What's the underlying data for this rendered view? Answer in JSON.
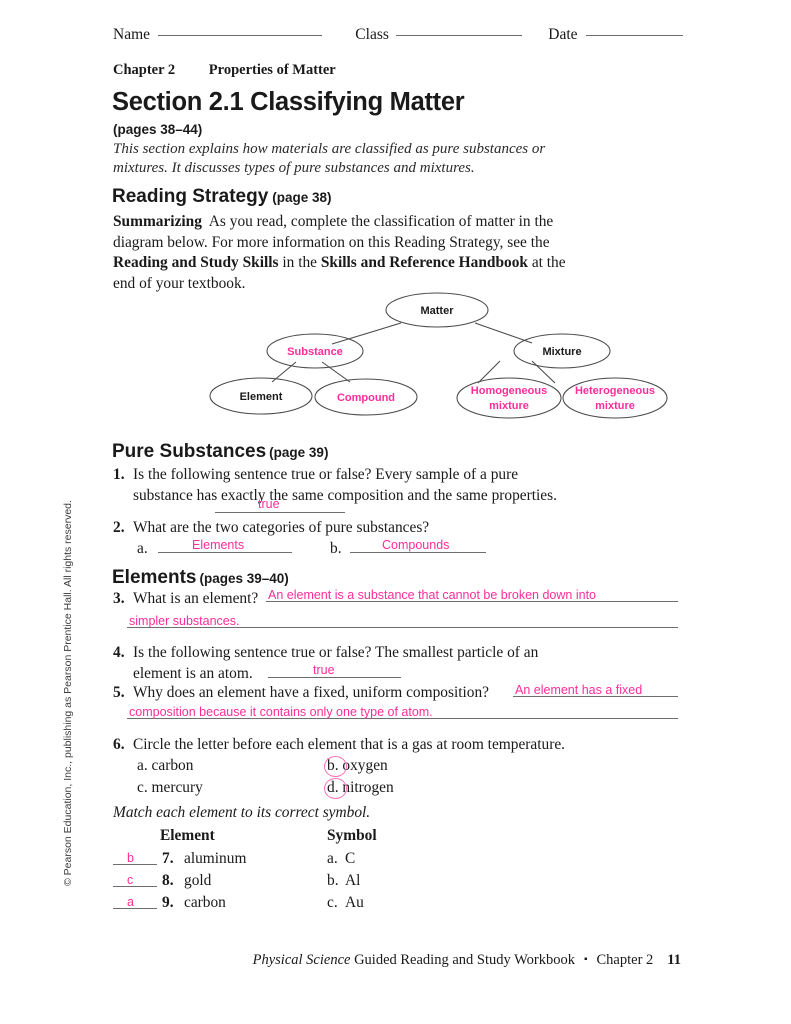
{
  "header": {
    "name_label": "Name",
    "class_label": "Class",
    "date_label": "Date",
    "chapter_label": "Chapter 2",
    "chapter_title": "Properties of Matter"
  },
  "section": {
    "title": "Section 2.1 Classifying Matter",
    "pages": "(pages 38–44)",
    "description": "This section explains how materials are classified as pure substances or mixtures. It discusses types of pure substances and mixtures."
  },
  "reading_strategy": {
    "heading": "Reading Strategy",
    "page_ref": "(page 38)",
    "lead_in": "Summarizing",
    "text_1": "As you read, complete the classification of matter in the diagram below. For more information on this Reading Strategy, see the ",
    "bold_1": "Reading and Study Skills",
    "text_2": " in the ",
    "bold_2": "Skills and Reference Handbook",
    "text_3": " at the end of your textbook."
  },
  "diagram": {
    "nodes": [
      {
        "id": "matter",
        "label": "Matter",
        "filled": false
      },
      {
        "id": "substance",
        "label": "Substance",
        "filled": true
      },
      {
        "id": "mixture",
        "label": "Mixture",
        "filled": false
      },
      {
        "id": "element",
        "label": "Element",
        "filled": false
      },
      {
        "id": "compound",
        "label": "Compound",
        "filled": true
      },
      {
        "id": "homogeneous",
        "label": "Homogeneous",
        "label2": "mixture",
        "filled": true
      },
      {
        "id": "heterogeneous",
        "label": "Heterogeneous",
        "label2": "mixture",
        "filled": true
      }
    ],
    "answer_color": "#FF2D9B"
  },
  "pure_substances": {
    "heading": "Pure Substances",
    "page_ref": "(page 39)",
    "q1": {
      "num": "1.",
      "text": "Is the following sentence true or false? Every sample of a pure substance has exactly the same composition and the same properties.",
      "answer": "true"
    },
    "q2": {
      "num": "2.",
      "text": "What are the two categories of pure substances?",
      "a_label": "a.",
      "a_answer": "Elements",
      "b_label": "b.",
      "b_answer": "Compounds"
    }
  },
  "elements": {
    "heading": "Elements",
    "page_ref": "(pages 39–40)",
    "q3": {
      "num": "3.",
      "text": "What is an element?",
      "answer_line1": "An element is a substance that cannot be broken down into",
      "answer_line2": "simpler substances."
    },
    "q4": {
      "num": "4.",
      "text": "Is the following sentence true or false? The smallest particle of an element is an atom.",
      "answer": "true"
    },
    "q5": {
      "num": "5.",
      "text": "Why does an element have a fixed, uniform composition?",
      "answer_line1": "An element has a fixed",
      "answer_line2": "composition because it contains only one type of atom."
    },
    "q6": {
      "num": "6.",
      "text": "Circle the letter before each element that is a gas at room temperature.",
      "choices": [
        {
          "letter": "a.",
          "label": "carbon",
          "circled": false
        },
        {
          "letter": "b.",
          "label": "oxygen",
          "circled": true
        },
        {
          "letter": "c.",
          "label": "mercury",
          "circled": false
        },
        {
          "letter": "d.",
          "label": "nitrogen",
          "circled": true
        }
      ]
    }
  },
  "matching": {
    "instruction": "Match each element to its correct symbol.",
    "col_element": "Element",
    "col_symbol": "Symbol",
    "rows": [
      {
        "answer": "b",
        "num": "7.",
        "element": "aluminum",
        "sym_letter": "a.",
        "symbol": "C"
      },
      {
        "answer": "c",
        "num": "8.",
        "element": "gold",
        "sym_letter": "b.",
        "symbol": "Al"
      },
      {
        "answer": "a",
        "num": "9.",
        "element": "carbon",
        "sym_letter": "c.",
        "symbol": "Au"
      }
    ]
  },
  "footer": {
    "italic_part": "Physical Science",
    "rest": " Guided Reading and Study Workbook",
    "bullet": "▪",
    "chapter": "Chapter 2",
    "page_number": "11"
  },
  "copyright": "© Pearson Education, Inc., publishing as Pearson Prentice Hall. All rights reserved."
}
